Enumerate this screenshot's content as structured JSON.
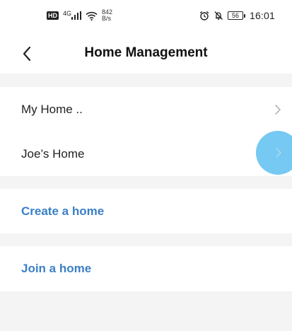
{
  "status_bar": {
    "hd_badge": "HD",
    "network_type": "4G",
    "speed_value": "842",
    "speed_unit": "B/s",
    "battery_level": "56",
    "time": "16:01",
    "icons": [
      "signal-icon",
      "wifi-icon",
      "alarm-icon",
      "mute-icon",
      "battery-icon"
    ]
  },
  "header": {
    "title": "Home Management",
    "back_icon": "chevron-left-icon"
  },
  "homes": [
    {
      "label": "My Home .."
    },
    {
      "label": "Joe’s Home"
    }
  ],
  "actions": {
    "create_label": "Create a home",
    "join_label": "Join a home"
  },
  "colors": {
    "accent": "#3a7fc6",
    "background": "#f4f4f4",
    "touch_indicator": "#66c3f1"
  }
}
